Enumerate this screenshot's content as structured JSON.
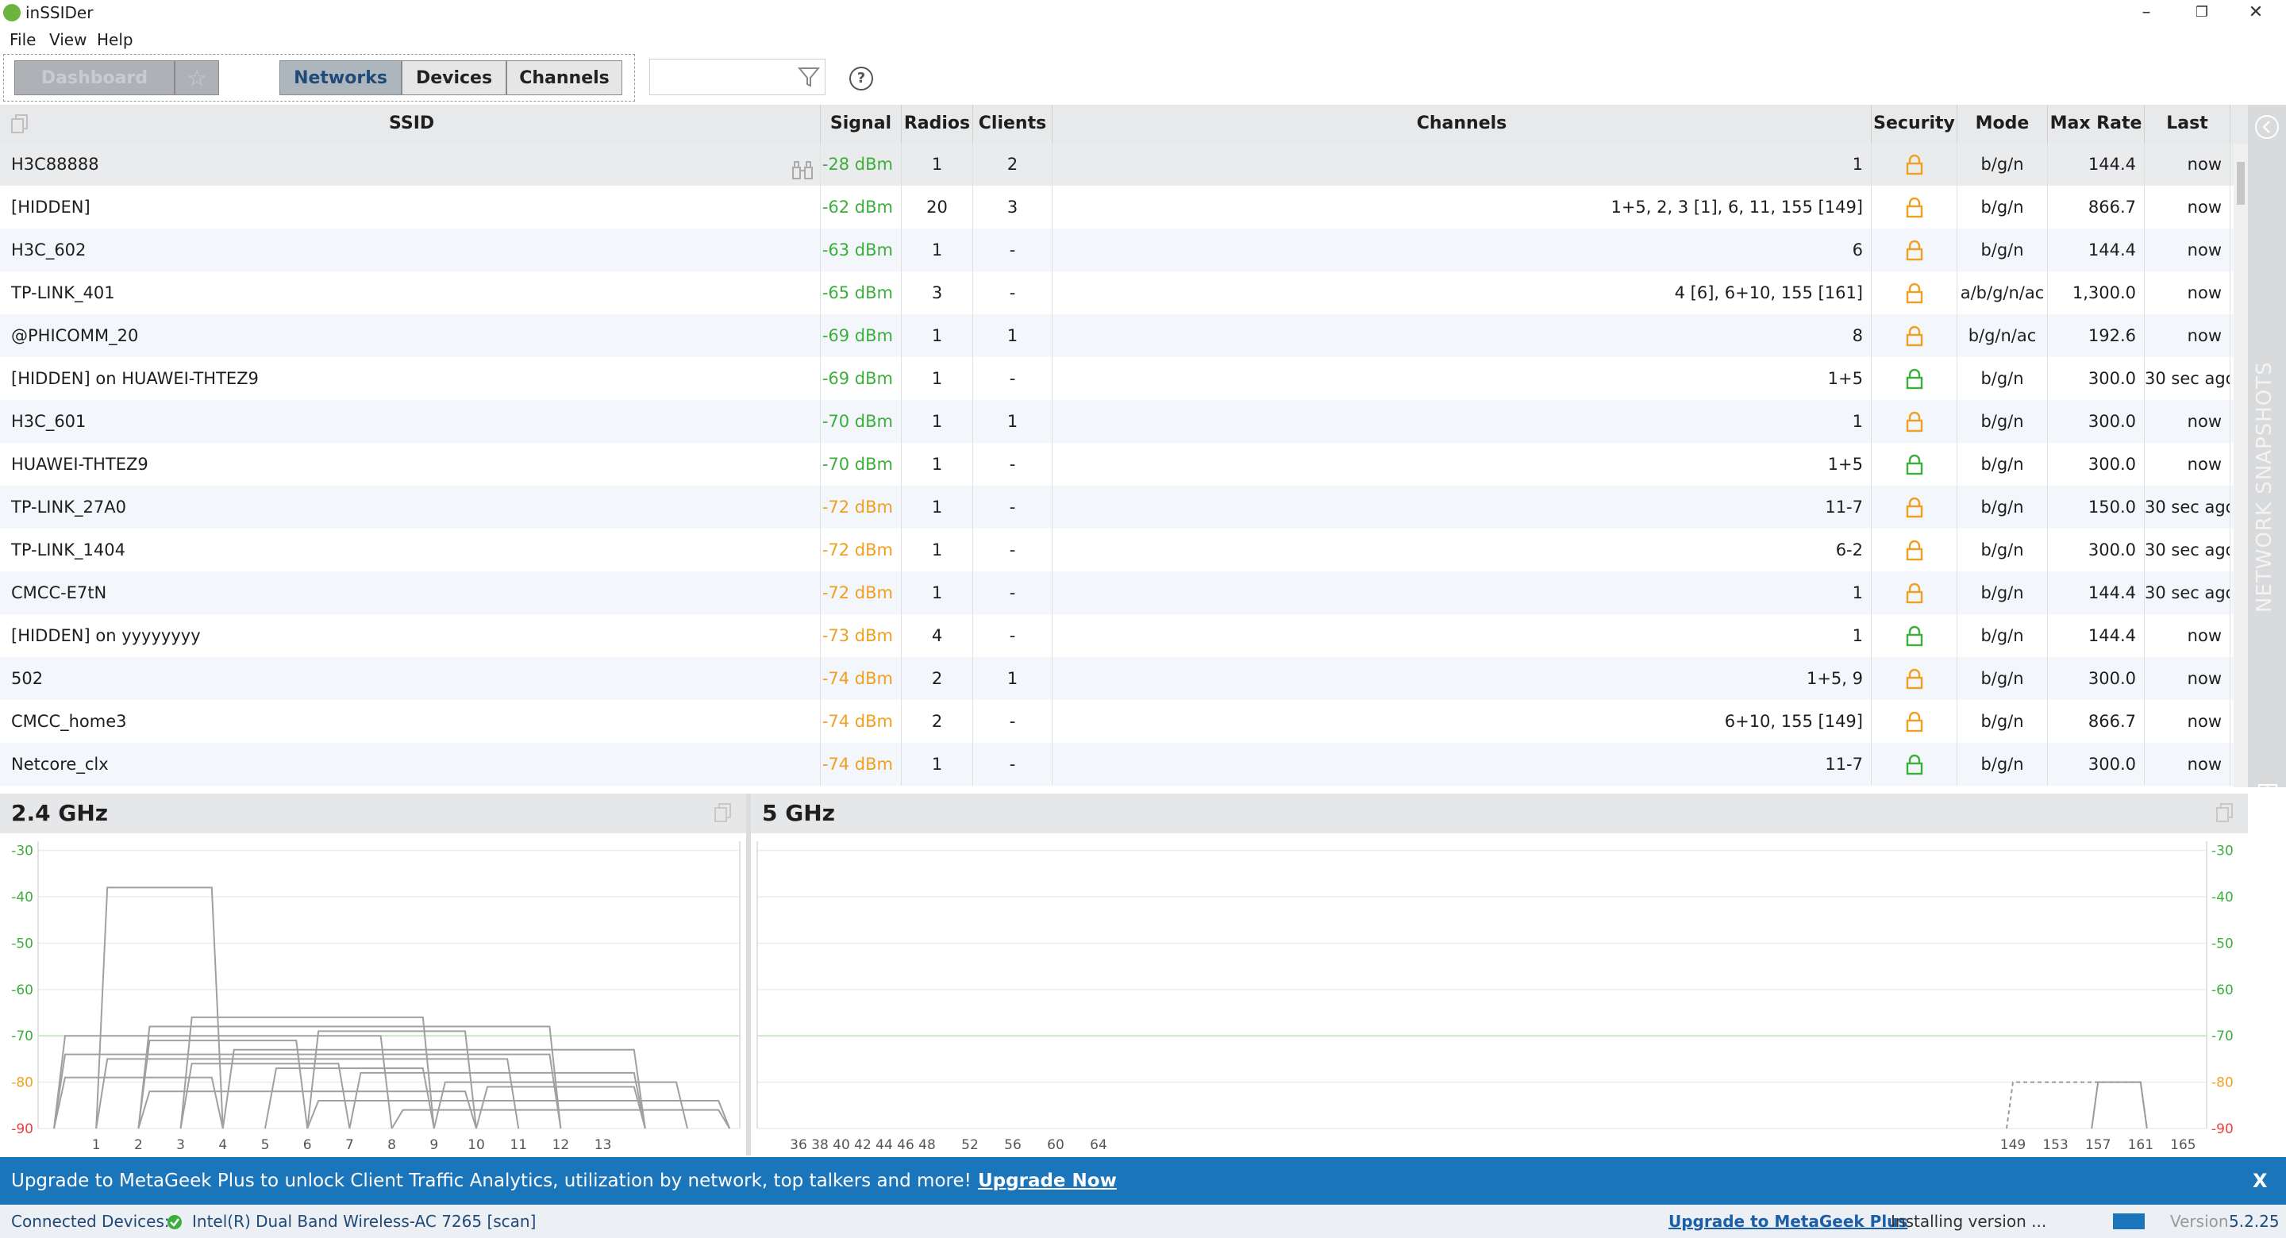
{
  "window": {
    "title": "inSSIDer",
    "minimize": "–",
    "restore": "❐",
    "close": "✕"
  },
  "menu": [
    "File",
    "View",
    "Help"
  ],
  "toolbar": {
    "dashboard": "Dashboard",
    "star": "☆",
    "tabs": [
      "Networks",
      "Devices",
      "Channels"
    ],
    "active_tab": "Networks",
    "search_value": "",
    "help": "?"
  },
  "table": {
    "headers": {
      "ssid": "SSID",
      "signal": "Signal",
      "radios": "Radios",
      "clients": "Clients",
      "channels": "Channels",
      "security": "Security",
      "mode": "Mode",
      "max_rate": "Max Rate",
      "last_seen": "Last Seen"
    },
    "rows": [
      {
        "ssid": "H3C88888",
        "signal": "-28 dBm",
        "signal_color": "#3cae3c",
        "radios": "1",
        "clients": "2",
        "channels": "1",
        "lock": "orange",
        "mode": "b/g/n",
        "max_rate": "144.4",
        "last_seen": "now"
      },
      {
        "ssid": "[HIDDEN]",
        "signal": "-62 dBm",
        "signal_color": "#3cae3c",
        "radios": "20",
        "clients": "3",
        "channels": "1+5, 2, 3 [1], 6, 11, 155 [149]",
        "lock": "orange",
        "mode": "b/g/n",
        "max_rate": "866.7",
        "last_seen": "now"
      },
      {
        "ssid": "H3C_602",
        "signal": "-63 dBm",
        "signal_color": "#3cae3c",
        "radios": "1",
        "clients": "-",
        "channels": "6",
        "lock": "orange",
        "mode": "b/g/n",
        "max_rate": "144.4",
        "last_seen": "now"
      },
      {
        "ssid": "TP-LINK_401",
        "signal": "-65 dBm",
        "signal_color": "#3cae3c",
        "radios": "3",
        "clients": "-",
        "channels": "4 [6], 6+10, 155 [161]",
        "lock": "orange",
        "mode": "a/b/g/n/ac",
        "max_rate": "1,300.0",
        "last_seen": "now"
      },
      {
        "ssid": "@PHICOMM_20",
        "signal": "-69 dBm",
        "signal_color": "#3cae3c",
        "radios": "1",
        "clients": "1",
        "channels": "8",
        "lock": "orange",
        "mode": "b/g/n/ac",
        "max_rate": "192.6",
        "last_seen": "now"
      },
      {
        "ssid": "[HIDDEN] on HUAWEI-THTEZ9",
        "signal": "-69 dBm",
        "signal_color": "#3cae3c",
        "radios": "1",
        "clients": "-",
        "channels": "1+5",
        "lock": "green",
        "mode": "b/g/n",
        "max_rate": "300.0",
        "last_seen": "30 sec ago"
      },
      {
        "ssid": "H3C_601",
        "signal": "-70 dBm",
        "signal_color": "#3cae3c",
        "radios": "1",
        "clients": "1",
        "channels": "1",
        "lock": "orange",
        "mode": "b/g/n",
        "max_rate": "300.0",
        "last_seen": "now"
      },
      {
        "ssid": "HUAWEI-THTEZ9",
        "signal": "-70 dBm",
        "signal_color": "#3cae3c",
        "radios": "1",
        "clients": "-",
        "channels": "1+5",
        "lock": "green",
        "mode": "b/g/n",
        "max_rate": "300.0",
        "last_seen": "now"
      },
      {
        "ssid": "TP-LINK_27A0",
        "signal": "-72 dBm",
        "signal_color": "#f0a020",
        "radios": "1",
        "clients": "-",
        "channels": "11-7",
        "lock": "orange",
        "mode": "b/g/n",
        "max_rate": "150.0",
        "last_seen": "30 sec ago"
      },
      {
        "ssid": "TP-LINK_1404",
        "signal": "-72 dBm",
        "signal_color": "#f0a020",
        "radios": "1",
        "clients": "-",
        "channels": "6-2",
        "lock": "orange",
        "mode": "b/g/n",
        "max_rate": "300.0",
        "last_seen": "30 sec ago"
      },
      {
        "ssid": "CMCC-E7tN",
        "signal": "-72 dBm",
        "signal_color": "#f0a020",
        "radios": "1",
        "clients": "-",
        "channels": "1",
        "lock": "orange",
        "mode": "b/g/n",
        "max_rate": "144.4",
        "last_seen": "30 sec ago"
      },
      {
        "ssid": "[HIDDEN] on yyyyyyyy",
        "signal": "-73 dBm",
        "signal_color": "#f0a020",
        "radios": "4",
        "clients": "-",
        "channels": "1",
        "lock": "green",
        "mode": "b/g/n",
        "max_rate": "144.4",
        "last_seen": "now"
      },
      {
        "ssid": "502",
        "signal": "-74 dBm",
        "signal_color": "#f0a020",
        "radios": "2",
        "clients": "1",
        "channels": "1+5, 9",
        "lock": "orange",
        "mode": "b/g/n",
        "max_rate": "300.0",
        "last_seen": "now"
      },
      {
        "ssid": "CMCC_home3",
        "signal": "-74 dBm",
        "signal_color": "#f0a020",
        "radios": "2",
        "clients": "-",
        "channels": "6+10, 155 [149]",
        "lock": "orange",
        "mode": "b/g/n",
        "max_rate": "866.7",
        "last_seen": "now"
      },
      {
        "ssid": "Netcore_clx",
        "signal": "-74 dBm",
        "signal_color": "#f0a020",
        "radios": "1",
        "clients": "-",
        "channels": "11-7",
        "lock": "green",
        "mode": "b/g/n",
        "max_rate": "300.0",
        "last_seen": "now"
      }
    ]
  },
  "sidebar": {
    "label": "NETWORK SNAPSHOTS"
  },
  "chart_data": [
    {
      "type": "area",
      "title": "2.4 GHz",
      "x_ticks": [
        1,
        2,
        3,
        4,
        5,
        6,
        7,
        8,
        9,
        10,
        11,
        12,
        13
      ],
      "y_ticks": [
        -30,
        -40,
        -50,
        -60,
        -70,
        -80,
        -90
      ],
      "xlim": [
        0,
        16
      ],
      "ylim": [
        -90,
        -28
      ],
      "series": [
        {
          "x": [
            1,
            4
          ],
          "y": -38
        },
        {
          "x": [
            3,
            9
          ],
          "y": -66
        },
        {
          "x": [
            2,
            12
          ],
          "y": -68
        },
        {
          "x": [
            6,
            10
          ],
          "y": -69
        },
        {
          "x": [
            0,
            8
          ],
          "y": -70
        },
        {
          "x": [
            2,
            6
          ],
          "y": -71
        },
        {
          "x": [
            4,
            14
          ],
          "y": -73
        },
        {
          "x": [
            0,
            12
          ],
          "y": -74
        },
        {
          "x": [
            1,
            11
          ],
          "y": -75
        },
        {
          "x": [
            3,
            7
          ],
          "y": -76
        },
        {
          "x": [
            5,
            9
          ],
          "y": -77
        },
        {
          "x": [
            7,
            14
          ],
          "y": -78
        },
        {
          "x": [
            0,
            4
          ],
          "y": -79
        },
        {
          "x": [
            9,
            15
          ],
          "y": -80
        },
        {
          "x": [
            10,
            14
          ],
          "y": -81
        },
        {
          "x": [
            2,
            10
          ],
          "y": -82
        },
        {
          "x": [
            6,
            16
          ],
          "y": -84
        },
        {
          "x": [
            8,
            16
          ],
          "y": -86
        }
      ]
    },
    {
      "type": "area",
      "title": "5 GHz",
      "x_ticks": [
        36,
        38,
        40,
        42,
        44,
        46,
        48,
        52,
        56,
        60,
        64,
        149,
        153,
        157,
        161,
        165
      ],
      "y_ticks": [
        -30,
        -40,
        -50,
        -60,
        -70,
        -80,
        -90
      ],
      "ylim": [
        -90,
        -28
      ],
      "series": [
        {
          "x": [
            149,
            161
          ],
          "y": -80,
          "dashed": true
        },
        {
          "x": [
            157,
            161
          ],
          "y": -80
        }
      ]
    }
  ],
  "banner": {
    "text": "Upgrade to MetaGeek Plus to unlock Client Traffic Analytics, utilization by network, top talkers and more!",
    "link": "Upgrade Now",
    "close": "X"
  },
  "status": {
    "connected_label": "Connected Devices:",
    "device": "Intel(R) Dual Band Wireless-AC 7265 [scan]",
    "upgrade_link": "Upgrade to MetaGeek Plus",
    "installing": "Installing version ...",
    "version_label": "Version",
    "version": "5.2.25"
  }
}
